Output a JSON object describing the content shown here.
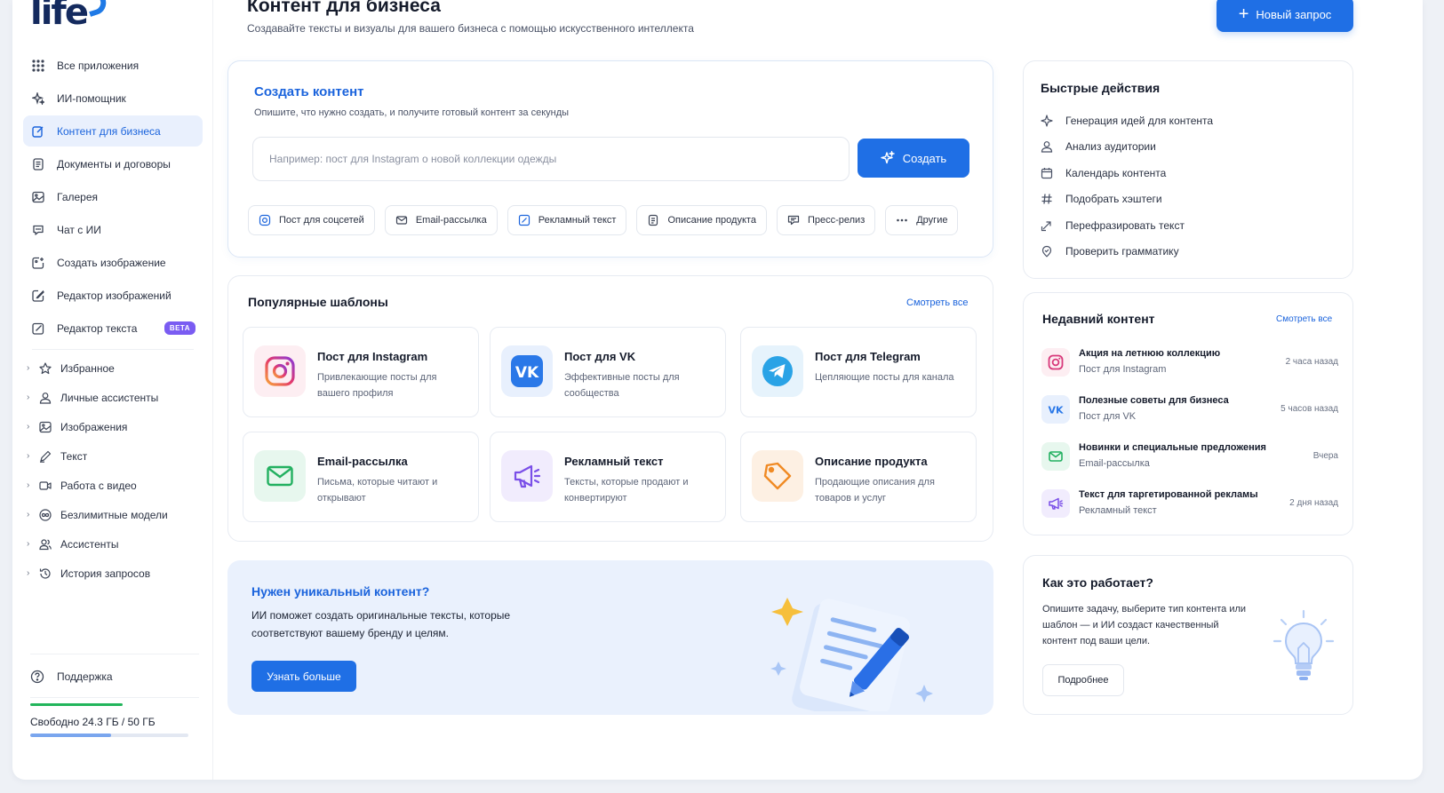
{
  "logo": {
    "text": "life"
  },
  "sidebar": {
    "nav": [
      {
        "label": "Все приложения",
        "icon": "grid-icon"
      },
      {
        "label": "ИИ-помощник",
        "icon": "sparkle-icon"
      },
      {
        "label": "Контент для бизнеса",
        "icon": "edit-square-icon",
        "active": true
      },
      {
        "label": "Документы и договоры",
        "icon": "document-icon"
      },
      {
        "label": "Галерея",
        "icon": "image-icon"
      },
      {
        "label": "Чат с ИИ",
        "icon": "chat-icon"
      },
      {
        "label": "Создать изображение",
        "icon": "image-plus-icon"
      },
      {
        "label": "Редактор изображений",
        "icon": "image-edit-icon"
      },
      {
        "label": "Редактор текста",
        "icon": "text-edit-icon",
        "badge": "BETA"
      }
    ],
    "groups": [
      {
        "label": "Избранное",
        "icon": "star-icon"
      },
      {
        "label": "Личные ассистенты",
        "icon": "user-icon"
      },
      {
        "label": "Изображения",
        "icon": "image-icon"
      },
      {
        "label": "Текст",
        "icon": "pen-icon"
      },
      {
        "label": "Работа с видео",
        "icon": "video-icon"
      },
      {
        "label": "Безлимитные модели",
        "icon": "infinity-icon"
      },
      {
        "label": "Ассистенты",
        "icon": "users-icon"
      },
      {
        "label": "История запросов",
        "icon": "history-icon"
      }
    ],
    "support": "Поддержка",
    "storage": {
      "text": "Свободно 24.3 ГБ / 50 ГБ",
      "used_fraction": 0.514
    }
  },
  "header": {
    "title": "Контент для бизнеса",
    "subtitle": "Создавайте тексты и визуалы для вашего бизнеса с помощью искусственного интеллекта",
    "new_button": "Новый запрос"
  },
  "create": {
    "title": "Создать контент",
    "desc": "Опишите, что нужно создать, и получите готовый контент за секунды",
    "placeholder": "Например: пост для Instagram о новой коллекции одежды",
    "button": "Создать",
    "chips": [
      {
        "label": "Пост для соцсетей",
        "icon": "social-post-icon"
      },
      {
        "label": "Email-рассылка",
        "icon": "mail-icon"
      },
      {
        "label": "Рекламный текст",
        "icon": "ad-text-icon"
      },
      {
        "label": "Описание продукта",
        "icon": "product-icon"
      },
      {
        "label": "Пресс-релиз",
        "icon": "press-icon"
      },
      {
        "label": "Другие",
        "icon": "more-icon"
      }
    ]
  },
  "templates": {
    "title": "Популярные шаблоны",
    "see_all": "Смотреть все",
    "items": [
      {
        "title": "Пост для Instagram",
        "desc": "Привлекающие посты для вашего профиля",
        "icon": "instagram-icon"
      },
      {
        "title": "Пост для VK",
        "desc": "Эффективные посты для сообщества",
        "icon": "vk-icon"
      },
      {
        "title": "Пост для Telegram",
        "desc": "Цепляющие посты для канала",
        "icon": "telegram-icon"
      },
      {
        "title": "Email-рассылка",
        "desc": "Письма, которые читают и открывают",
        "icon": "mail-icon"
      },
      {
        "title": "Рекламный текст",
        "desc": "Тексты, которые продают и конвертируют",
        "icon": "megaphone-icon"
      },
      {
        "title": "Описание продукта",
        "desc": "Продающие описания для товаров и услуг",
        "icon": "tag-icon"
      }
    ]
  },
  "promo": {
    "title": "Нужен уникальный контент?",
    "text": "ИИ поможет создать оригинальные тексты, которые соответствуют вашему бренду и целям.",
    "button": "Узнать больше"
  },
  "quick": {
    "title": "Быстрые действия",
    "items": [
      {
        "label": "Генерация идей для контента",
        "icon": "sparkle-icon"
      },
      {
        "label": "Анализ аудитории",
        "icon": "user-icon"
      },
      {
        "label": "Календарь контента",
        "icon": "calendar-icon"
      },
      {
        "label": "Подобрать хэштеги",
        "icon": "hashtag-icon"
      },
      {
        "label": "Перефразировать текст",
        "icon": "rephrase-icon"
      },
      {
        "label": "Проверить грамматику",
        "icon": "check-icon"
      }
    ]
  },
  "recent": {
    "title": "Недавний контент",
    "see_all": "Смотреть все",
    "items": [
      {
        "title": "Акция на летнюю коллекцию",
        "sub": "Пост для Instagram",
        "time": "2 часа назад",
        "icon": "instagram-icon"
      },
      {
        "title": "Полезные советы для бизнеса",
        "sub": "Пост для VK",
        "time": "5 часов назад",
        "icon": "vk-icon"
      },
      {
        "title": "Новинки и специальные предложения",
        "sub": "Email-рассылка",
        "time": "Вчера",
        "icon": "mail-icon"
      },
      {
        "title": "Текст для таргетированной рекламы",
        "sub": "Рекламный текст",
        "time": "2 дня назад",
        "icon": "megaphone-icon"
      }
    ]
  },
  "how": {
    "title": "Как это работает?",
    "text": "Опишите задачу, выберите тип контента или шаблон — и ИИ создаст качественный контент под ваши цели.",
    "button": "Подробнее"
  },
  "colors": {
    "accent": "#1f6fe5",
    "beta": "#7a5cf2",
    "storage_used": "#22b55b"
  }
}
